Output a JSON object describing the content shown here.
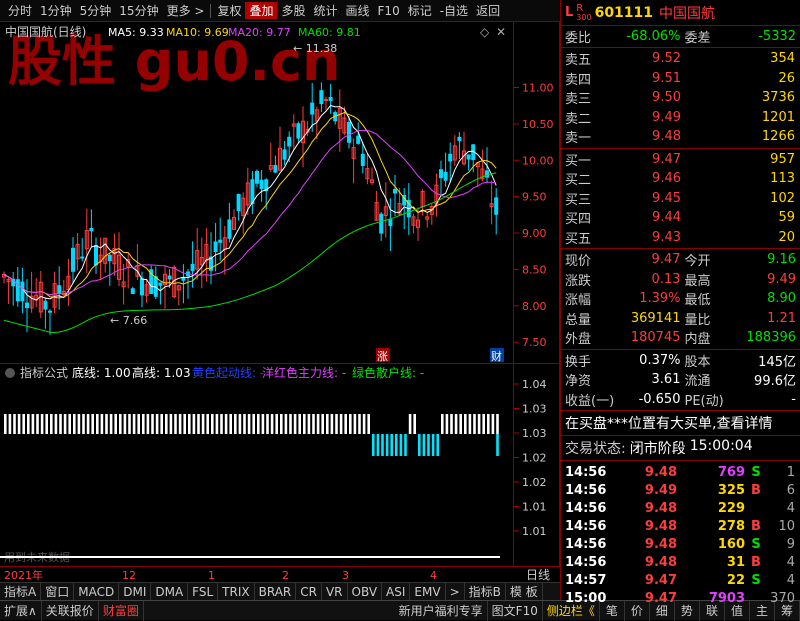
{
  "toolbar": {
    "items": [
      "分时",
      "1分钟",
      "5分钟",
      "15分钟",
      "更多 >",
      "复权",
      "叠加",
      "多股",
      "统计",
      "画线",
      "F10",
      "标记",
      "-自选",
      "返回"
    ],
    "active_index": 6
  },
  "chart": {
    "title": "中国国航(日线)",
    "ma": [
      {
        "label": "MA5: 9.33",
        "color": "#ffffff"
      },
      {
        "label": "MA10: 9.69",
        "color": "#ffd700"
      },
      {
        "label": "MA20: 9.77",
        "color": "#e040ff"
      },
      {
        "label": "MA60: 9.81",
        "color": "#00e000"
      }
    ],
    "high_label": "11.38",
    "low_label": "7.66",
    "badge_zhang": "涨",
    "badge_cai": "财",
    "watermark": "股性 gu0.cn",
    "price_ticks": [
      "11.00",
      "10.50",
      "10.00",
      "9.50",
      "9.00",
      "8.50",
      "8.00",
      "7.50"
    ]
  },
  "chart_data": {
    "type": "candlestick",
    "title": "中国国航(日线)",
    "y_ticks": [
      7.5,
      8.0,
      8.5,
      9.0,
      9.5,
      10.0,
      10.5,
      11.0
    ],
    "ylim": [
      7.2,
      11.9
    ],
    "high": 11.38,
    "low": 7.66,
    "x_tick_labels": [
      "2021年",
      "12",
      "1",
      "2",
      "3",
      "4"
    ]
  },
  "indicator": {
    "name": "指标公式",
    "bottom_line": "底线: 1.00",
    "top_line": "高线: 1.03",
    "line1": "黄色起动线: -",
    "line2": "洋红色主力线: -",
    "line3": "绿色散户线: -",
    "note": "用到未来数据",
    "ticks": [
      "1.04",
      "1.03",
      "1.03",
      "1.02",
      "1.02",
      "1.01",
      "1.01"
    ]
  },
  "xaxis": {
    "labels": [
      "2021年",
      "12",
      "1",
      "2",
      "3",
      "4"
    ],
    "right": "日线"
  },
  "tabs": [
    "指标A",
    "窗口",
    "MACD",
    "DMI",
    "DMA",
    "FSL",
    "TRIX",
    "BRAR",
    "CR",
    "VR",
    "OBV",
    "ASI",
    "EMV",
    ">",
    "指标B",
    "模 板"
  ],
  "status": {
    "left": [
      "扩展∧",
      "关联报价",
      "财富圈"
    ],
    "right": [
      "新用户福利专享",
      "图文F10",
      "侧边栏《",
      "笔",
      "价",
      "细",
      "势",
      "联",
      "值",
      "主",
      "筹"
    ]
  },
  "quote": {
    "code": "601111",
    "name": "中国国航",
    "flag_l": "L",
    "flag_r": "R",
    "flag_num": "300",
    "weibi_label": "委比",
    "weibi": "-68.06%",
    "weicha_label": "委差",
    "weicha": "-5332",
    "sells": [
      {
        "label": "卖五",
        "price": "9.52",
        "vol": "354"
      },
      {
        "label": "卖四",
        "price": "9.51",
        "vol": "26"
      },
      {
        "label": "卖三",
        "price": "9.50",
        "vol": "3736"
      },
      {
        "label": "卖二",
        "price": "9.49",
        "vol": "1201"
      },
      {
        "label": "卖一",
        "price": "9.48",
        "vol": "1266"
      }
    ],
    "buys": [
      {
        "label": "买一",
        "price": "9.47",
        "vol": "957"
      },
      {
        "label": "买二",
        "price": "9.46",
        "vol": "113"
      },
      {
        "label": "买三",
        "price": "9.45",
        "vol": "102"
      },
      {
        "label": "买四",
        "price": "9.44",
        "vol": "59"
      },
      {
        "label": "买五",
        "price": "9.43",
        "vol": "20"
      }
    ],
    "stats": [
      {
        "l1": "现价",
        "v1": "9.47",
        "c1": "red",
        "l2": "今开",
        "v2": "9.16",
        "c2": "grn"
      },
      {
        "l1": "涨跌",
        "v1": "0.13",
        "c1": "red",
        "l2": "最高",
        "v2": "9.49",
        "c2": "red"
      },
      {
        "l1": "涨幅",
        "v1": "1.39%",
        "c1": "red",
        "l2": "最低",
        "v2": "8.90",
        "c2": "grn"
      },
      {
        "l1": "总量",
        "v1": "369141",
        "c1": "ylw",
        "l2": "量比",
        "v2": "1.21",
        "c2": "red"
      },
      {
        "l1": "外盘",
        "v1": "180745",
        "c1": "red",
        "l2": "内盘",
        "v2": "188396",
        "c2": "grn"
      }
    ],
    "stats2": [
      {
        "l1": "换手",
        "v1": "0.37%",
        "l2": "股本",
        "v2": "145亿"
      },
      {
        "l1": "净资",
        "v1": "3.61",
        "l2": "流通",
        "v2": "99.6亿"
      },
      {
        "l1": "收益(一)",
        "v1": "-0.650",
        "l2": "PE(动)",
        "v2": "-"
      }
    ],
    "news": "在买盘***位置有大买单,查看详情",
    "trade_state_label": "交易状态:",
    "trade_state": "闭市阶段",
    "trade_time": "15:00:04",
    "ticks": [
      {
        "t": "14:56",
        "p": "9.48",
        "v": "769",
        "bs": "S",
        "n": "1",
        "vc": "mag"
      },
      {
        "t": "14:56",
        "p": "9.49",
        "v": "325",
        "bs": "B",
        "n": "6",
        "vc": "ylw"
      },
      {
        "t": "14:56",
        "p": "9.48",
        "v": "229",
        "bs": "",
        "n": "4",
        "vc": "ylw"
      },
      {
        "t": "14:56",
        "p": "9.48",
        "v": "278",
        "bs": "B",
        "n": "10",
        "vc": "ylw"
      },
      {
        "t": "14:56",
        "p": "9.48",
        "v": "160",
        "bs": "S",
        "n": "9",
        "vc": "ylw"
      },
      {
        "t": "14:56",
        "p": "9.48",
        "v": "31",
        "bs": "B",
        "n": "4",
        "vc": "ylw"
      },
      {
        "t": "14:57",
        "p": "9.47",
        "v": "22",
        "bs": "S",
        "n": "4",
        "vc": "ylw"
      },
      {
        "t": "15:00",
        "p": "9.47",
        "v": "7903",
        "bs": "",
        "n": "370",
        "vc": "mag"
      }
    ]
  }
}
